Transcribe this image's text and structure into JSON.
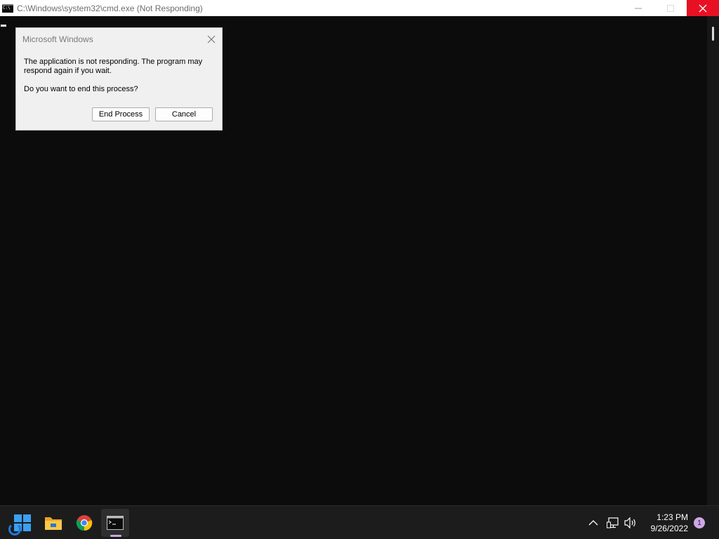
{
  "window": {
    "title": "C:\\Windows\\system32\\cmd.exe (Not Responding)",
    "controls": {
      "minimize_icon": "minimize-icon",
      "maximize_icon": "maximize-icon",
      "close_icon": "close-icon",
      "close_color": "#e81123"
    }
  },
  "dialog": {
    "title": "Microsoft Windows",
    "message": "The application is not responding. The program may respond again if you wait.",
    "question": "Do you want to end this process?",
    "buttons": {
      "end_process": "End Process",
      "cancel": "Cancel"
    }
  },
  "taskbar": {
    "apps": [
      {
        "name": "start",
        "icon": "windows-start-icon",
        "accent": "#3aa0f3"
      },
      {
        "name": "file-explorer",
        "icon": "folder-icon",
        "accent": "#f6c142"
      },
      {
        "name": "chrome",
        "icon": "chrome-icon"
      },
      {
        "name": "command-prompt",
        "icon": "terminal-icon",
        "active": true
      }
    ],
    "tray": {
      "chevron_icon": "chevron-up-icon",
      "network_icon": "network-icon",
      "volume_icon": "volume-icon"
    },
    "clock": {
      "time": "1:23 PM",
      "date": "9/26/2022"
    },
    "notification_count": "1"
  }
}
